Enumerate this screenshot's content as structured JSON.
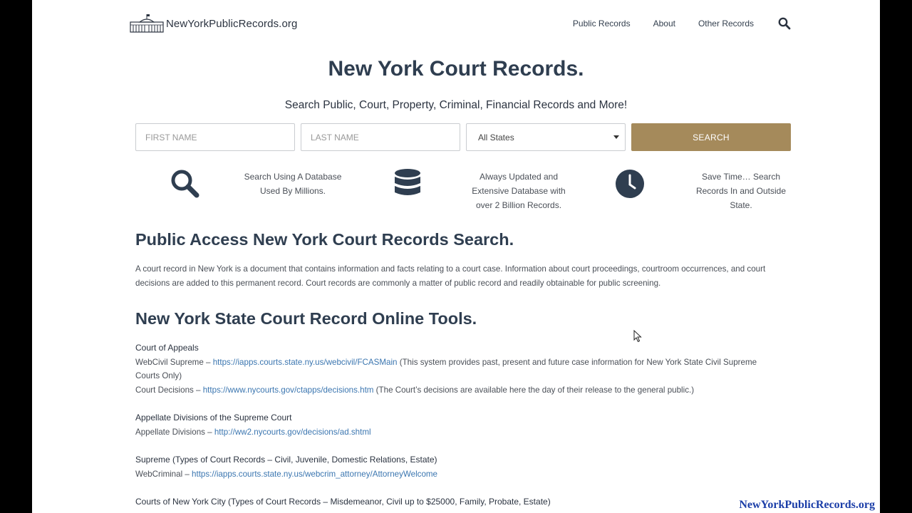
{
  "header": {
    "logo_text": "NewYorkPublicRecords.org",
    "nav": [
      "Public Records",
      "About",
      "Other Records"
    ]
  },
  "hero": {
    "title": "New York Court Records.",
    "subtitle": "Search Public, Court, Property, Criminal, Financial Records and More!"
  },
  "search_form": {
    "first_name_placeholder": "FIRST NAME",
    "last_name_placeholder": "LAST NAME",
    "state_selected": "All States",
    "search_label": "SEARCH"
  },
  "features": [
    {
      "icon": "magnifier-icon",
      "lines": [
        "Search Using A Database",
        "Used By Millions."
      ]
    },
    {
      "icon": "database-icon",
      "lines": [
        "Always Updated and",
        "Extensive Database with",
        "over 2 Billion Records."
      ]
    },
    {
      "icon": "clock-icon",
      "lines": [
        "Save Time… Search",
        "Records In and Outside",
        "State."
      ]
    }
  ],
  "section1": {
    "heading": "Public Access New York Court Records Search.",
    "para_lines": [
      "A court record in New York is a document that contains information and facts relating to a court case. Information about court proceedings, courtroom occurrences, and court",
      "decisions are added to this permanent record. Court records are commonly a matter of public record and readily obtainable for public screening."
    ]
  },
  "section2": {
    "heading": "New York State Court Record Online Tools.",
    "court_of_appeals": {
      "heading": "Court of Appeals",
      "webcivil_prefix": "WebCivil Supreme – ",
      "webcivil_link": "https://iapps.courts.state.ny.us/webcivil/FCASMain",
      "webcivil_suffix_1": " (This system provides past, present and future case information for New York State Civil Supreme",
      "webcivil_suffix_2": "Courts Only)",
      "decisions_prefix": "Court Decisions – ",
      "decisions_link": "https://www.nycourts.gov/ctapps/decisions.htm",
      "decisions_suffix": " (The Court’s decisions are available here the day of their release to the general public.)"
    },
    "appellate": {
      "heading": "Appellate Divisions of the Supreme Court",
      "prefix": "Appellate Divisions – ",
      "link": "http://ww2.nycourts.gov/decisions/ad.shtml"
    },
    "supreme": {
      "heading": "Supreme (Types of Court Records – Civil, Juvenile, Domestic Relations, Estate)",
      "prefix": "WebCriminal – ",
      "link": "https://iapps.courts.state.ny.us/webcrim_attorney/AttorneyWelcome"
    },
    "nyc": {
      "heading": "Courts of New York City (Types of Court Records – Misdemeanor, Civil up to $25000, Family, Probate, Estate)"
    }
  },
  "watermark": "NewYorkPublicRecords.org",
  "colors": {
    "button": "#a58a5b",
    "heading": "#2f3e50",
    "link": "#3b76b0",
    "watermark": "#1b3ea8"
  }
}
